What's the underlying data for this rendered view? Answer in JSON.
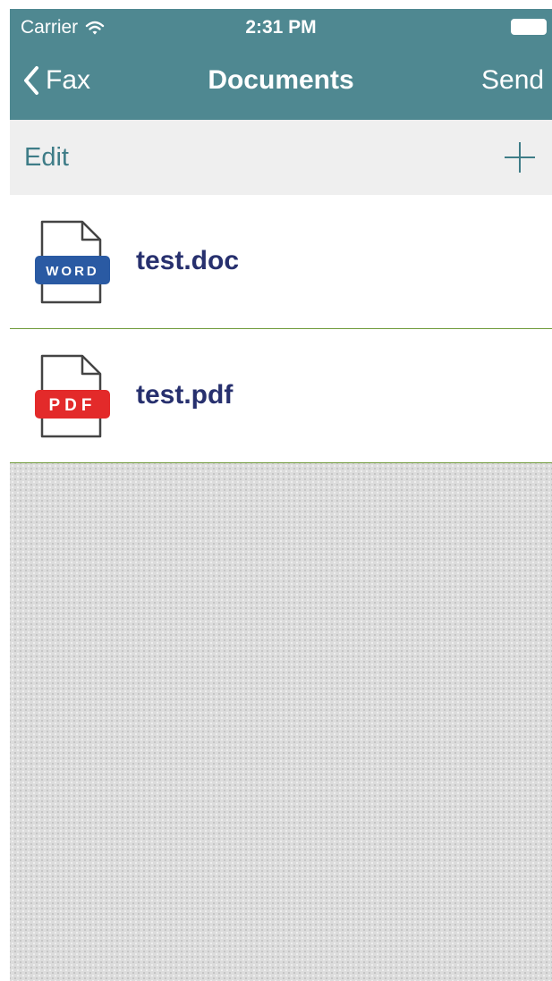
{
  "status_bar": {
    "carrier": "Carrier",
    "time": "2:31 PM",
    "wifi_icon": "wifi-icon",
    "battery_icon": "battery-icon"
  },
  "nav": {
    "back_label": "Fax",
    "back_icon": "chevron-left-icon",
    "title": "Documents",
    "send_label": "Send"
  },
  "toolbar": {
    "edit_label": "Edit",
    "add_icon": "plus-icon"
  },
  "files": [
    {
      "name": "test.doc",
      "badge": "WORD",
      "icon": "word-document-icon",
      "badge_color": "#2a5aa3"
    },
    {
      "name": "test.pdf",
      "badge": "PDF",
      "icon": "pdf-document-icon",
      "badge_color": "#e32a2a"
    }
  ],
  "colors": {
    "header_background": "#4f8891",
    "toolbar_background": "#efefef",
    "accent": "#3e7c87",
    "file_name_text": "#27306e",
    "row_separator": "#6f9a3a"
  }
}
